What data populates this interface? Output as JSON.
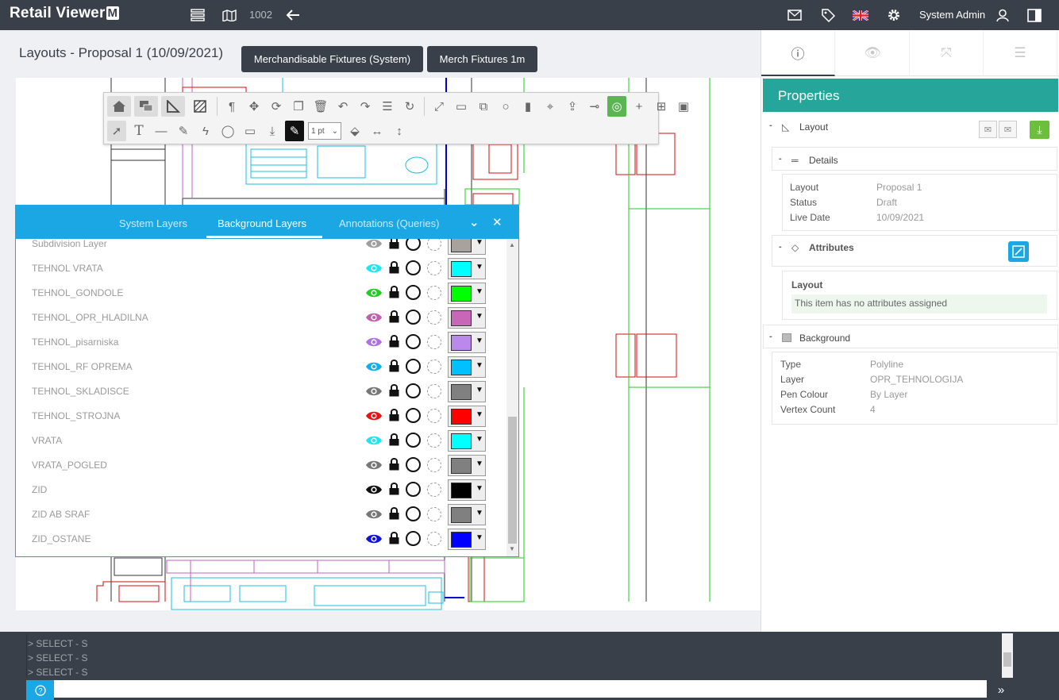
{
  "app": {
    "brand": "Retail Viewer",
    "brand_mark": "M",
    "store_id": "1002",
    "user": "System Admin"
  },
  "page": {
    "title": "Layouts - Proposal 1 (10/09/2021)",
    "buttons": [
      "Merchandisable Fixtures (System)",
      "Merch Fixtures 1m"
    ]
  },
  "toolbar": {
    "line_weight": "1 pt"
  },
  "layers_panel": {
    "tabs": [
      "System Layers",
      "Background Layers",
      "Annotations (Queries)"
    ],
    "active_tab": "Background Layers",
    "layers": [
      {
        "name": "Subdivision Layer",
        "eye": "#9e9e9e",
        "color": "#a8a29e"
      },
      {
        "name": "TEHNOL VRATA",
        "eye": "#1ee6f0",
        "color": "#00ffff"
      },
      {
        "name": "TEHNOL_GONDOLE",
        "eye": "#22cc22",
        "color": "#00ff00"
      },
      {
        "name": "TEHNOL_OPR_HLADILNA",
        "eye": "#c060b0",
        "color": "#c866b8"
      },
      {
        "name": "TEHNOL_pisarniska",
        "eye": "#b070e0",
        "color": "#bb88ee"
      },
      {
        "name": "TEHNOL_RF OPREMA",
        "eye": "#0ab0f0",
        "color": "#00c0ff"
      },
      {
        "name": "TEHNOL_SKLADISCE",
        "eye": "#777777",
        "color": "#808080"
      },
      {
        "name": "TEHNOL_STROJNA",
        "eye": "#ee1111",
        "color": "#ff0000"
      },
      {
        "name": "VRATA",
        "eye": "#1ee6f0",
        "color": "#00ffff"
      },
      {
        "name": "VRATA_POGLED",
        "eye": "#777777",
        "color": "#808080"
      },
      {
        "name": "ZID",
        "eye": "#111111",
        "color": "#000000"
      },
      {
        "name": "ZID AB SRAF",
        "eye": "#777777",
        "color": "#808080"
      },
      {
        "name": "ZID_OSTANE",
        "eye": "#1111dd",
        "color": "#0000ff"
      }
    ]
  },
  "properties": {
    "heading": "Properties",
    "layout_section": "Layout",
    "details_section": "Details",
    "details": [
      {
        "key": "Layout",
        "value": "Proposal 1"
      },
      {
        "key": "Status",
        "value": "Draft"
      },
      {
        "key": "Live Date",
        "value": "10/09/2021"
      }
    ],
    "attributes_section": "Attributes",
    "attr_group": "Layout",
    "attr_empty": "This item has no attributes assigned",
    "background_section": "Background",
    "background": [
      {
        "key": "Type",
        "value": "Polyline"
      },
      {
        "key": "Layer",
        "value": "OPR_TEHNOLOGIJA"
      },
      {
        "key": "Pen Colour",
        "value": "By Layer"
      },
      {
        "key": "Vertex Count",
        "value": "4"
      }
    ]
  },
  "console": {
    "lines": [
      "> SELECT - S",
      "> SELECT - S",
      "> SELECT - S"
    ],
    "help_icon": "?"
  }
}
